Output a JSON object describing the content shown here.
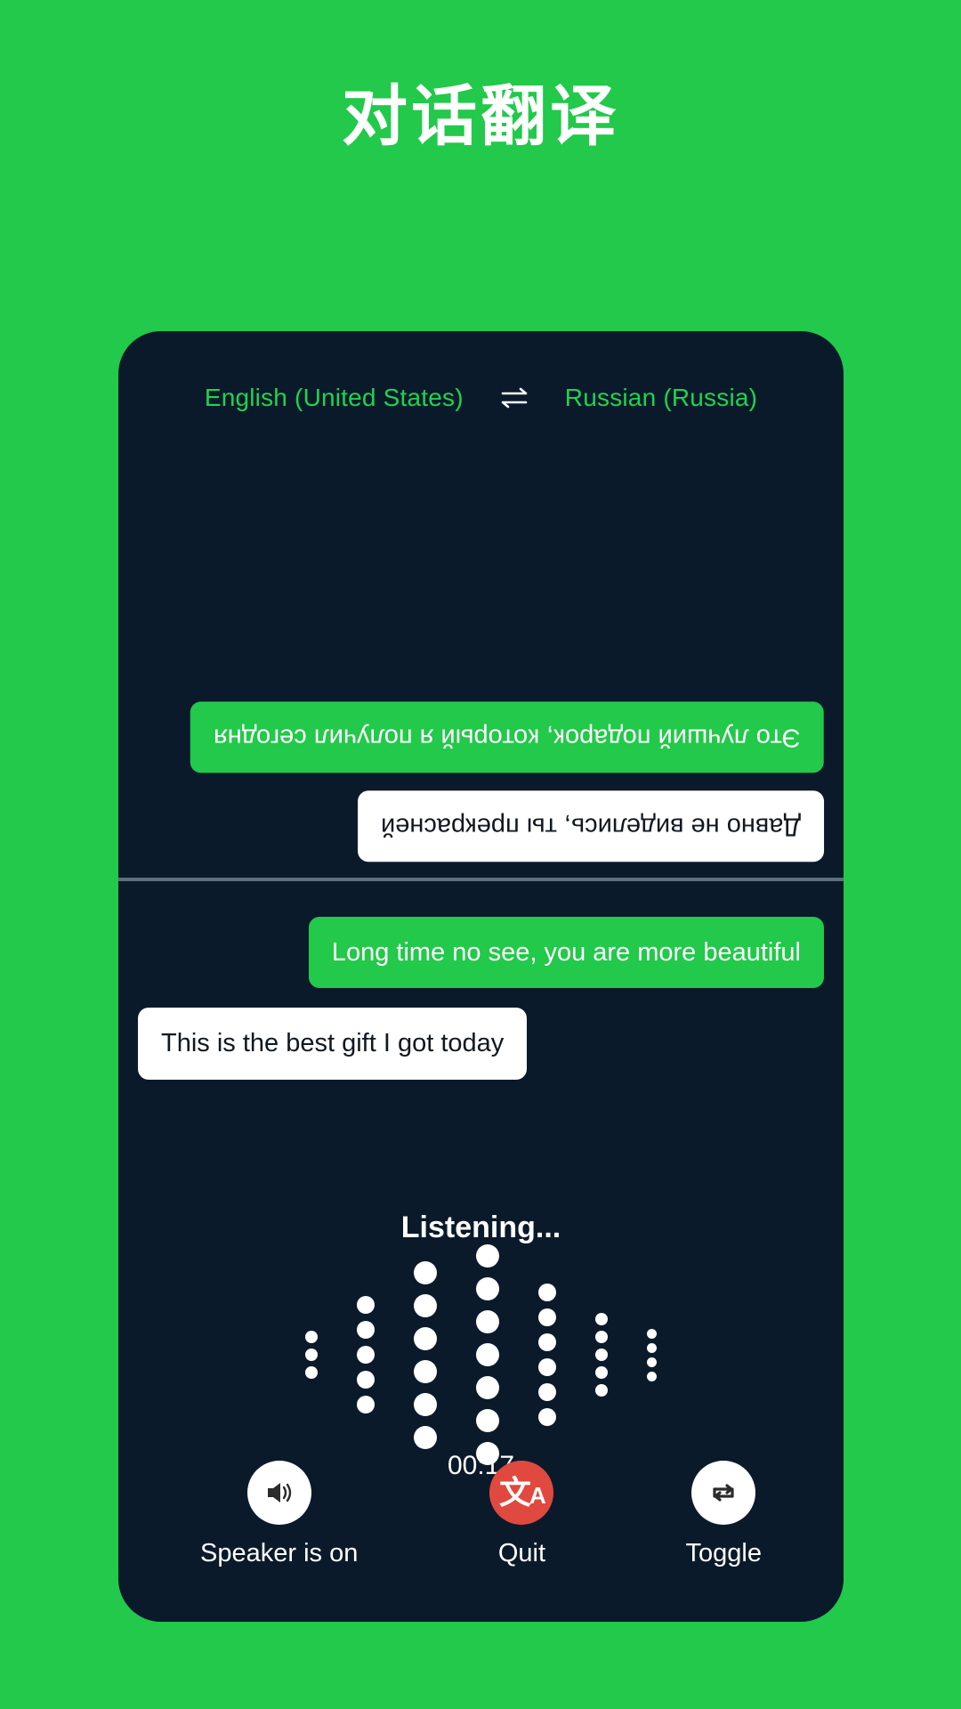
{
  "page": {
    "title": "对话翻译",
    "background_color": "#22c94a",
    "card_color": "#0b1a2b",
    "accent_green": "#22c94a",
    "accent_red": "#e0493f",
    "lang_text_color": "#1fd34f"
  },
  "language_bar": {
    "source": "English (United States)",
    "target": "Russian (Russia)",
    "swap_icon": "swap-horizontal-icon"
  },
  "conversation": {
    "remote_messages": [
      {
        "text": "Это лучший подарок, который я получил сегодня",
        "style": "green",
        "align": "right",
        "rotated": true
      },
      {
        "text": "Давно не виделись, ты прекрасней",
        "style": "white",
        "align": "right",
        "rotated": true
      }
    ],
    "local_messages": [
      {
        "text": "Long time no see, you are more beautiful",
        "style": "green",
        "align": "right",
        "rotated": false
      },
      {
        "text": "This is the best gift I got today",
        "style": "white",
        "align": "left",
        "rotated": false
      }
    ]
  },
  "listening": {
    "status": "Listening...",
    "timer": "00:17",
    "waveform_columns": [
      {
        "dots": 3,
        "size": 14
      },
      {
        "dots": 5,
        "size": 20
      },
      {
        "dots": 6,
        "size": 26
      },
      {
        "dots": 7,
        "size": 26
      },
      {
        "dots": 6,
        "size": 20
      },
      {
        "dots": 5,
        "size": 14
      },
      {
        "dots": 4,
        "size": 11
      }
    ]
  },
  "controls": [
    {
      "label": "Speaker is on",
      "icon": "speaker-on-icon",
      "circle": "light"
    },
    {
      "label": "Quit",
      "icon": "translate-icon",
      "circle": "red"
    },
    {
      "label": "Toggle",
      "icon": "repeat-swap-icon",
      "circle": "light"
    }
  ]
}
